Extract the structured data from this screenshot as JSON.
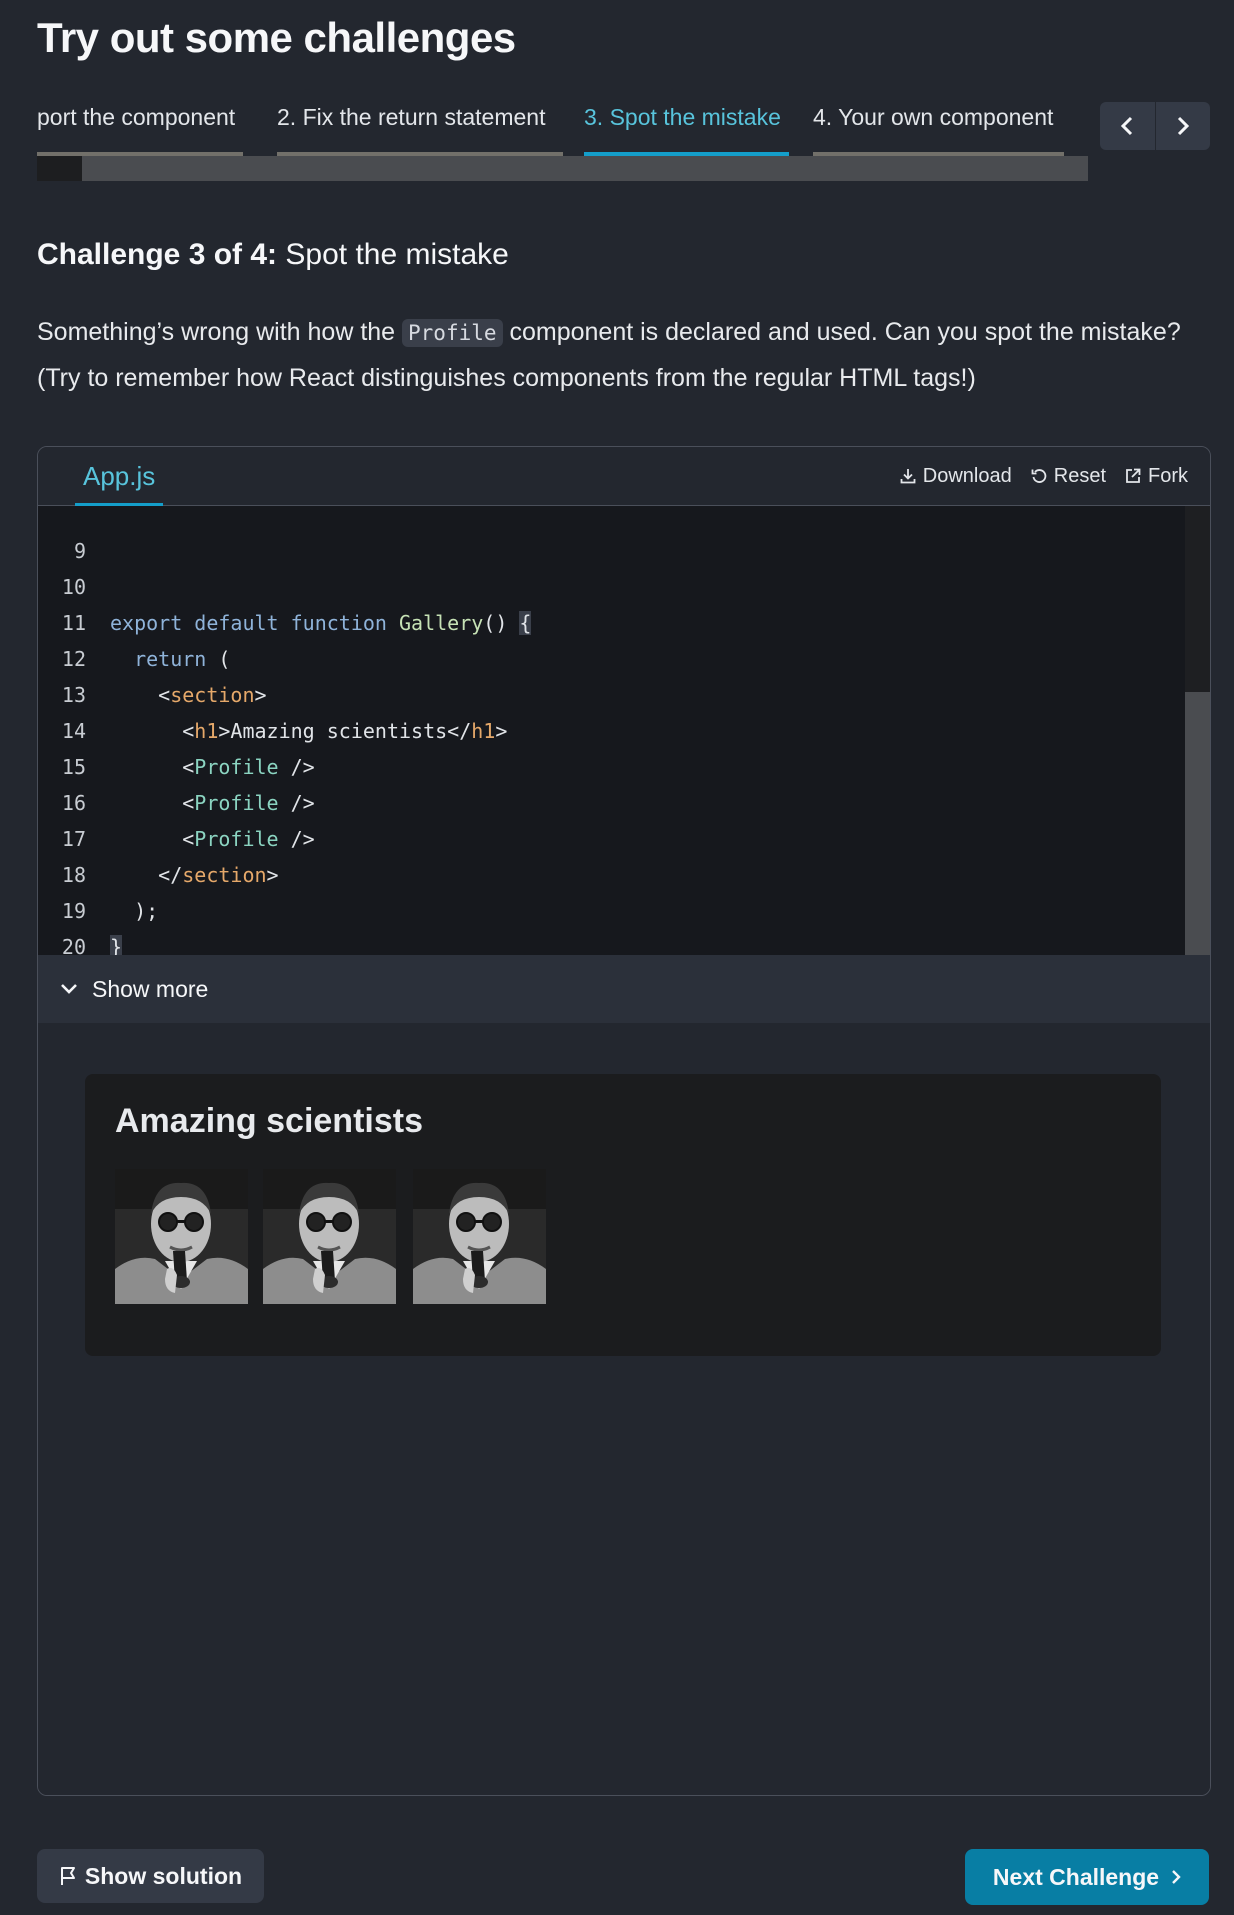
{
  "section_title": "Try out some challenges",
  "tabs": [
    {
      "label": "port the component",
      "active": false
    },
    {
      "label": "2. Fix the return statement",
      "active": false
    },
    {
      "label": "3. Spot the mistake",
      "active": true
    },
    {
      "label": "4. Your own component",
      "active": false
    }
  ],
  "challenge": {
    "prefix": "Challenge 3 of 4:",
    "name": "Spot the mistake",
    "desc_before": "Something’s wrong with how the ",
    "desc_code": "Profile",
    "desc_after": " component is declared and used. Can you spot the mistake? (Try to remember how React distinguishes components from the regular HTML tags!)"
  },
  "sandbox": {
    "file_tab": "App.js",
    "actions": {
      "download": "Download",
      "reset": "Reset",
      "fork": "Fork"
    },
    "line_numbers": [
      "9",
      "10",
      "11",
      "12",
      "13",
      "14",
      "15",
      "16",
      "17",
      "18",
      "19",
      "20"
    ],
    "show_more": "Show more"
  },
  "preview": {
    "heading": "Amazing scientists",
    "photo_count": 3,
    "photo_alt": "scientist-photo"
  },
  "footer": {
    "show_solution": "Show solution",
    "next_challenge": "Next Challenge"
  },
  "colors": {
    "page_bg": "#23272f",
    "accent": "#58c4dc",
    "button_blue": "#087ea4",
    "editor_bg": "#16181d"
  }
}
